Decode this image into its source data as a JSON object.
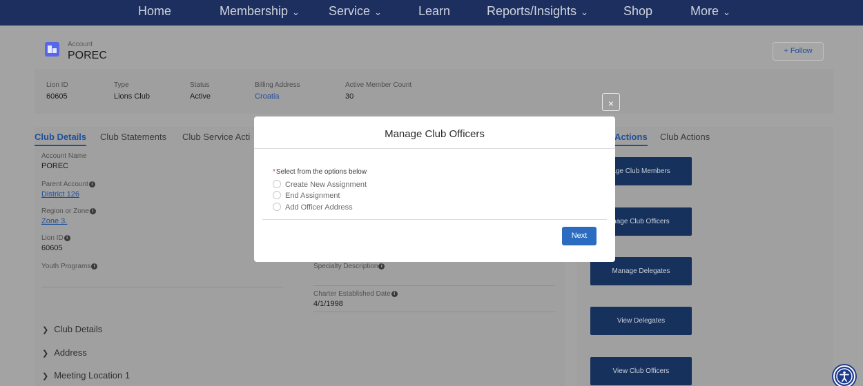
{
  "nav": {
    "items": [
      {
        "label": "Home",
        "chevron": false
      },
      {
        "label": "Membership",
        "chevron": true
      },
      {
        "label": "Service",
        "chevron": true
      },
      {
        "label": "Learn",
        "chevron": false
      },
      {
        "label": "Reports/Insights",
        "chevron": true
      },
      {
        "label": "Shop",
        "chevron": false
      },
      {
        "label": "More",
        "chevron": true
      }
    ]
  },
  "account": {
    "object_label": "Account",
    "name": "POREC",
    "follow_label": "+ Follow"
  },
  "highlights": [
    {
      "label": "Lion ID",
      "value": "60605",
      "link": false
    },
    {
      "label": "Type",
      "value": "Lions Club",
      "link": false
    },
    {
      "label": "Status",
      "value": "Active",
      "link": false
    },
    {
      "label": "Billing Address",
      "value": "Croatia",
      "link": true
    },
    {
      "label": "Active Member Count",
      "value": "30",
      "link": false
    }
  ],
  "left_tabs": [
    "Club Details",
    "Club Statements",
    "Club Service Acti"
  ],
  "fields": {
    "account_name": {
      "label": "Account Name",
      "value": "POREC"
    },
    "parent_account": {
      "label": "Parent Account",
      "value": "District 126"
    },
    "region_zone": {
      "label": "Region or Zone",
      "value": "Zone 3."
    },
    "lion_id": {
      "label": "Lion ID",
      "value": "60605"
    },
    "youth_programs": {
      "label": "Youth Programs",
      "value": ""
    },
    "specialty_description": {
      "label": "Specialty Description",
      "value": ""
    },
    "charter_date": {
      "label": "Charter Established Date",
      "value": "4/1/1998"
    }
  },
  "sections": [
    "Club Details",
    "Address",
    "Meeting Location 1"
  ],
  "right_tabs": [
    "Actions",
    "Club Actions"
  ],
  "actions": [
    "age Club Members",
    "nage Club Officers",
    "Manage Delegates",
    "View Delegates",
    "View Club Officers"
  ],
  "modal": {
    "title": "Manage Club Officers",
    "required_label": "Select from the options below",
    "options": [
      "Create New Assignment",
      "End Assignment",
      "Add Officer Address"
    ],
    "next_label": "Next",
    "close_glyph": "×"
  },
  "colors": {
    "nav_bg": "#1d2f5e",
    "accent": "#1f4f9a",
    "button_brand": "#2b6cc0",
    "required": "#c23934"
  }
}
